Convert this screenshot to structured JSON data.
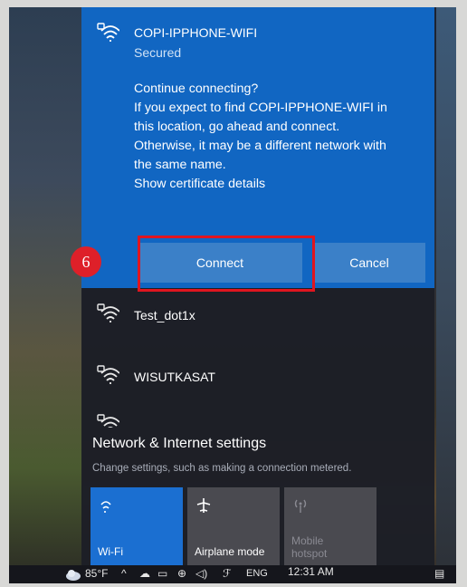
{
  "selected_network": {
    "name": "COPI-IPPHONE-WIFI",
    "status": "Secured",
    "message_lines": [
      "Continue connecting?",
      "If you expect to find COPI-IPPHONE-WIFI in",
      "this location, go ahead and connect.",
      "Otherwise, it may be a different network with",
      "the same name.",
      "Show certificate details"
    ],
    "connect_label": "Connect",
    "cancel_label": "Cancel"
  },
  "step_badge": "6",
  "networks": [
    {
      "name": "Test_dot1x"
    },
    {
      "name": "WISUTKASAT"
    }
  ],
  "settings": {
    "title": "Network & Internet settings",
    "subtitle": "Change settings, such as making a connection metered."
  },
  "quick_actions": [
    {
      "label": "Wi-Fi",
      "state": "on",
      "icon": "wifi-icon"
    },
    {
      "label": "Airplane mode",
      "state": "off",
      "icon": "airplane-icon"
    },
    {
      "label_line1": "Mobile",
      "label_line2": "hotspot",
      "state": "disabled",
      "icon": "hotspot-icon"
    }
  ],
  "taskbar": {
    "temperature": "85°F",
    "language": "ENG",
    "time": "12:31 AM"
  },
  "colors": {
    "selected_bg": "#1166c2",
    "button_bg": "#3b80c8",
    "highlight": "#e0151f",
    "flyout_bg": "#1c1e26",
    "wifi_tile": "#1b6fd1"
  }
}
